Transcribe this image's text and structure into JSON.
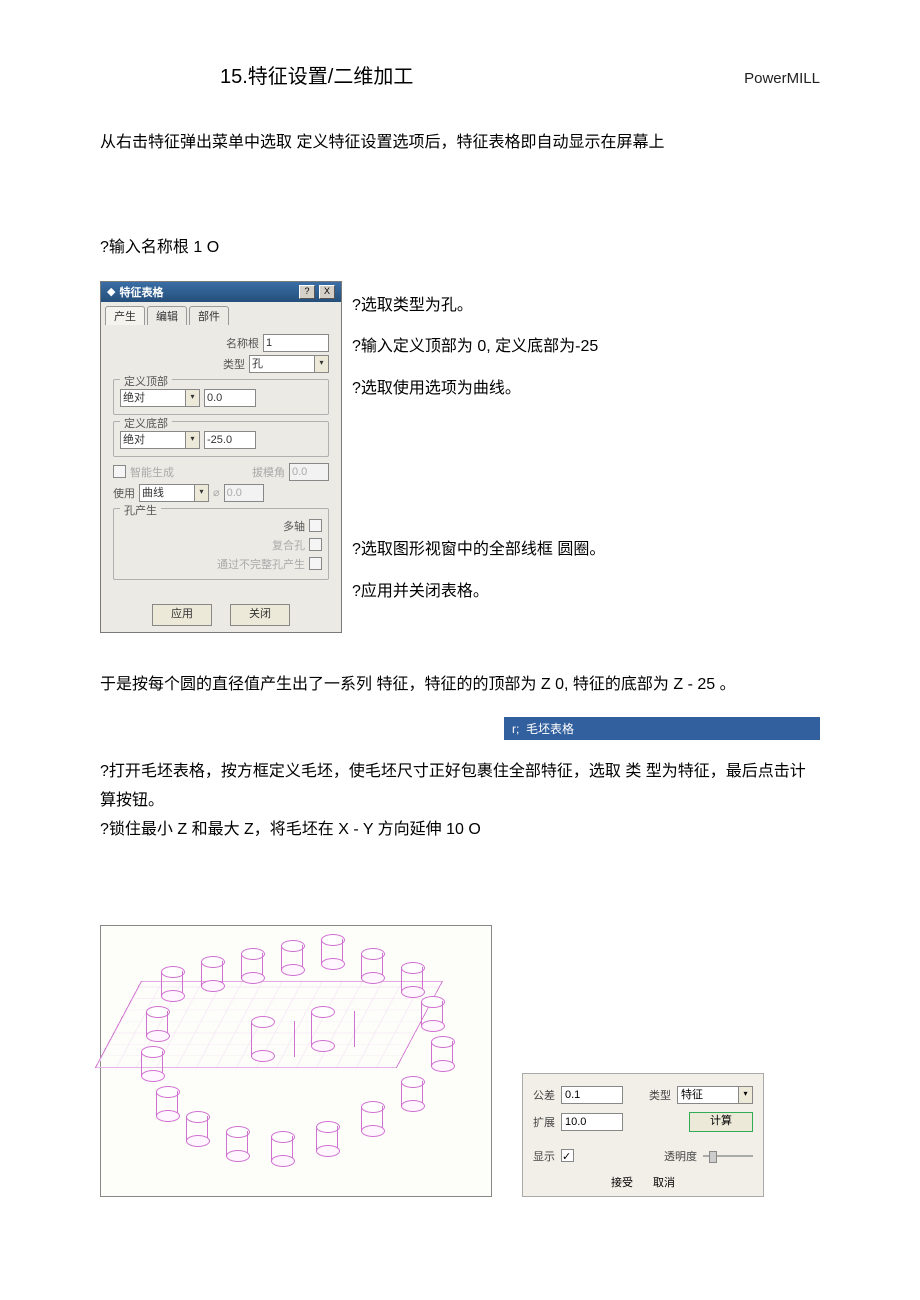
{
  "header": {
    "chapter": "15.特征设置/二维加工",
    "brand": "PowerMILL"
  },
  "p1": "从右击特征弹出菜单中选取  定义特征设置选项后，特征表格即自动显示在屏幕上",
  "p2": "?输入名称根 1  O",
  "side": {
    "a": "?选取类型为孔。",
    "b": "?输入定义顶部为 0, 定义底部为-25",
    "c": "?选取使用选项为曲线。",
    "d": "?选取图形视窗中的全部线框  圆圈。",
    "e": "?应用并关闭表格。"
  },
  "dlg": {
    "title": "特征表格",
    "close": "X",
    "help": "?",
    "tabs": {
      "t1": "产生",
      "t2": "编辑",
      "t3": "部件"
    },
    "nameroot_label": "名称根",
    "nameroot_value": "1",
    "type_label": "类型",
    "type_value": "孔",
    "top_legend": "定义顶部",
    "top_mode": "绝对",
    "top_value": "0.0",
    "bot_legend": "定义底部",
    "bot_mode": "绝对",
    "bot_value": "-25.0",
    "smartgen": "智能生成",
    "draft_label": "拔模角",
    "draft_value": "0.0",
    "use_label": "使用",
    "use_value": "曲线",
    "diam_value": "0.0",
    "hole_legend": "孔产生",
    "multiaxis": "多轴",
    "compound": "复合孔",
    "viapartial": "通过不完整孔产生",
    "apply": "应用",
    "close_btn": "关闭"
  },
  "bluebar": "毛坯表格",
  "p3": "于是按每个圆的直径值产生出了一系列  特征，特征的的顶部为 Z  0, 特征的底部为 Z  - 25  。",
  "p4a": "?打开毛坯表格，按方框定义毛坯，使毛坯尺寸正好包裹住全部特征，选取  类  型为特征，最后点击计算按钮。",
  "p4b": "?锁住最小 Z 和最大 Z，将毛坯在 X  -  Y 方向延伸 10  O",
  "cfg": {
    "tol_l": "公差",
    "tol_v": "0.1",
    "type_l": "类型",
    "type_v": "特征",
    "exp_l": "扩展",
    "exp_v": "10.0",
    "calc": "计算",
    "show_l": "显示",
    "trans_l": "透明度",
    "accept": "接受",
    "cancel": "取消"
  }
}
